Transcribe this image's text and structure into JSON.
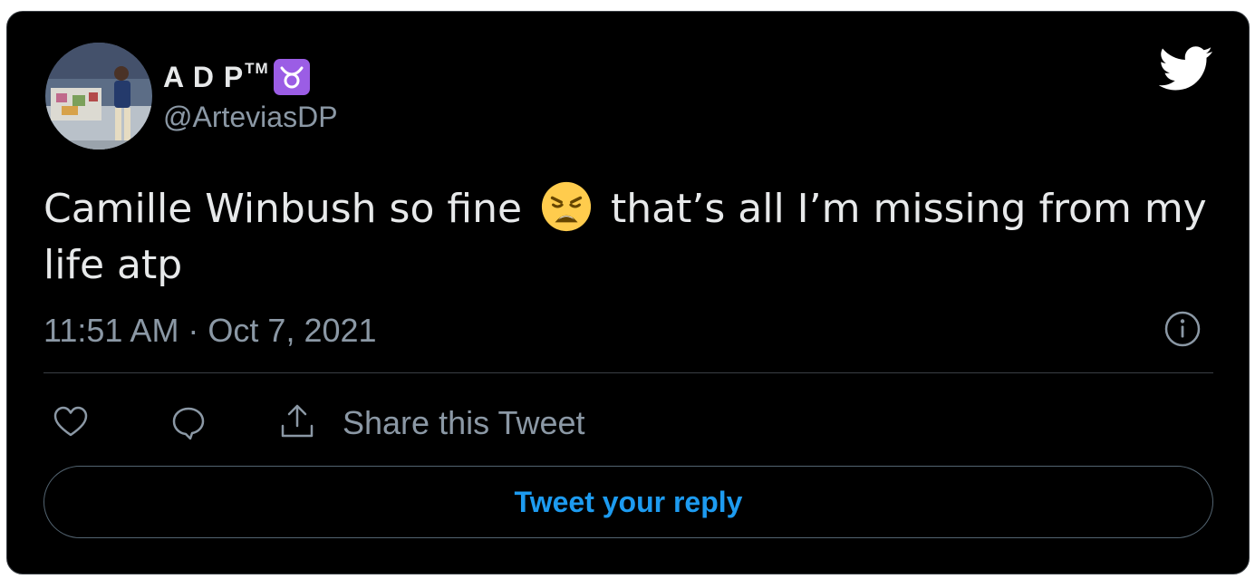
{
  "user": {
    "display_name": "A D P",
    "trademark": "TM",
    "zodiac_icon": "taurus-icon",
    "handle": "@ArteviasDP"
  },
  "tweet": {
    "text_before_emoji": "Camille Winbush so fine ",
    "emoji": "weary-face-emoji",
    "text_after_emoji": " that’s all I’m missing from my life atp",
    "timestamp": "11:51 AM · Oct 7, 2021"
  },
  "actions": {
    "like_icon": "heart-icon",
    "reply_icon": "speech-bubble-icon",
    "share_icon": "share-icon",
    "share_label": "Share this Tweet"
  },
  "reply_button": {
    "label": "Tweet your reply"
  },
  "colors": {
    "background": "#000000",
    "text_primary": "#e7e9ea",
    "text_secondary": "#8b98a5",
    "accent_blue": "#1d9bf0",
    "zodiac_purple": "#9b5de5"
  }
}
